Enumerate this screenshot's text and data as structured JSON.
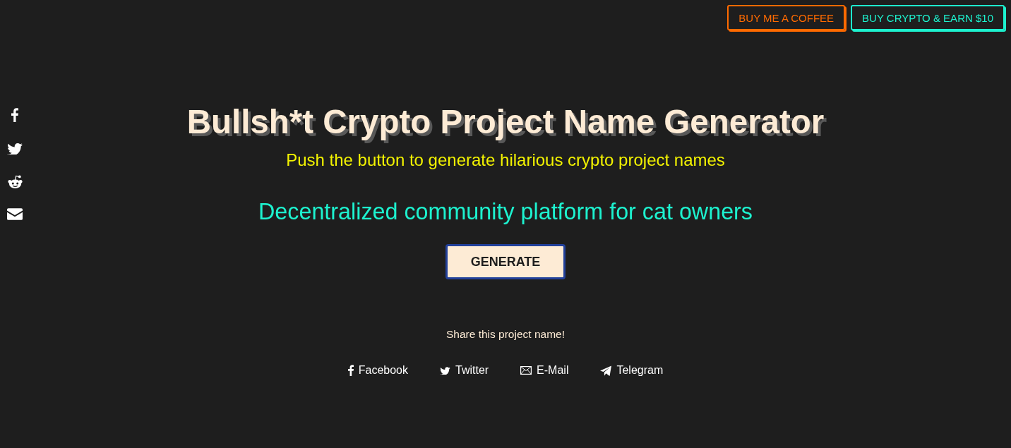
{
  "header_buttons": [
    {
      "label": "BUY ME A COFFEE",
      "color": "#ff6a00"
    },
    {
      "label": "BUY CRYPTO & EARN $10",
      "color": "#1df2cf"
    }
  ],
  "title": "Bullsh*t Crypto Project Name Generator",
  "subtitle": "Push the button to generate hilarious crypto project names",
  "generated_name": "Decentralized community platform for cat owners",
  "generate_button": {
    "label": "GENERATE",
    "focused": true
  },
  "share": {
    "heading": "Share this project name!",
    "links": [
      {
        "label": "Facebook"
      },
      {
        "label": "Twitter"
      },
      {
        "label": "E-Mail"
      },
      {
        "label": "Telegram"
      }
    ]
  }
}
